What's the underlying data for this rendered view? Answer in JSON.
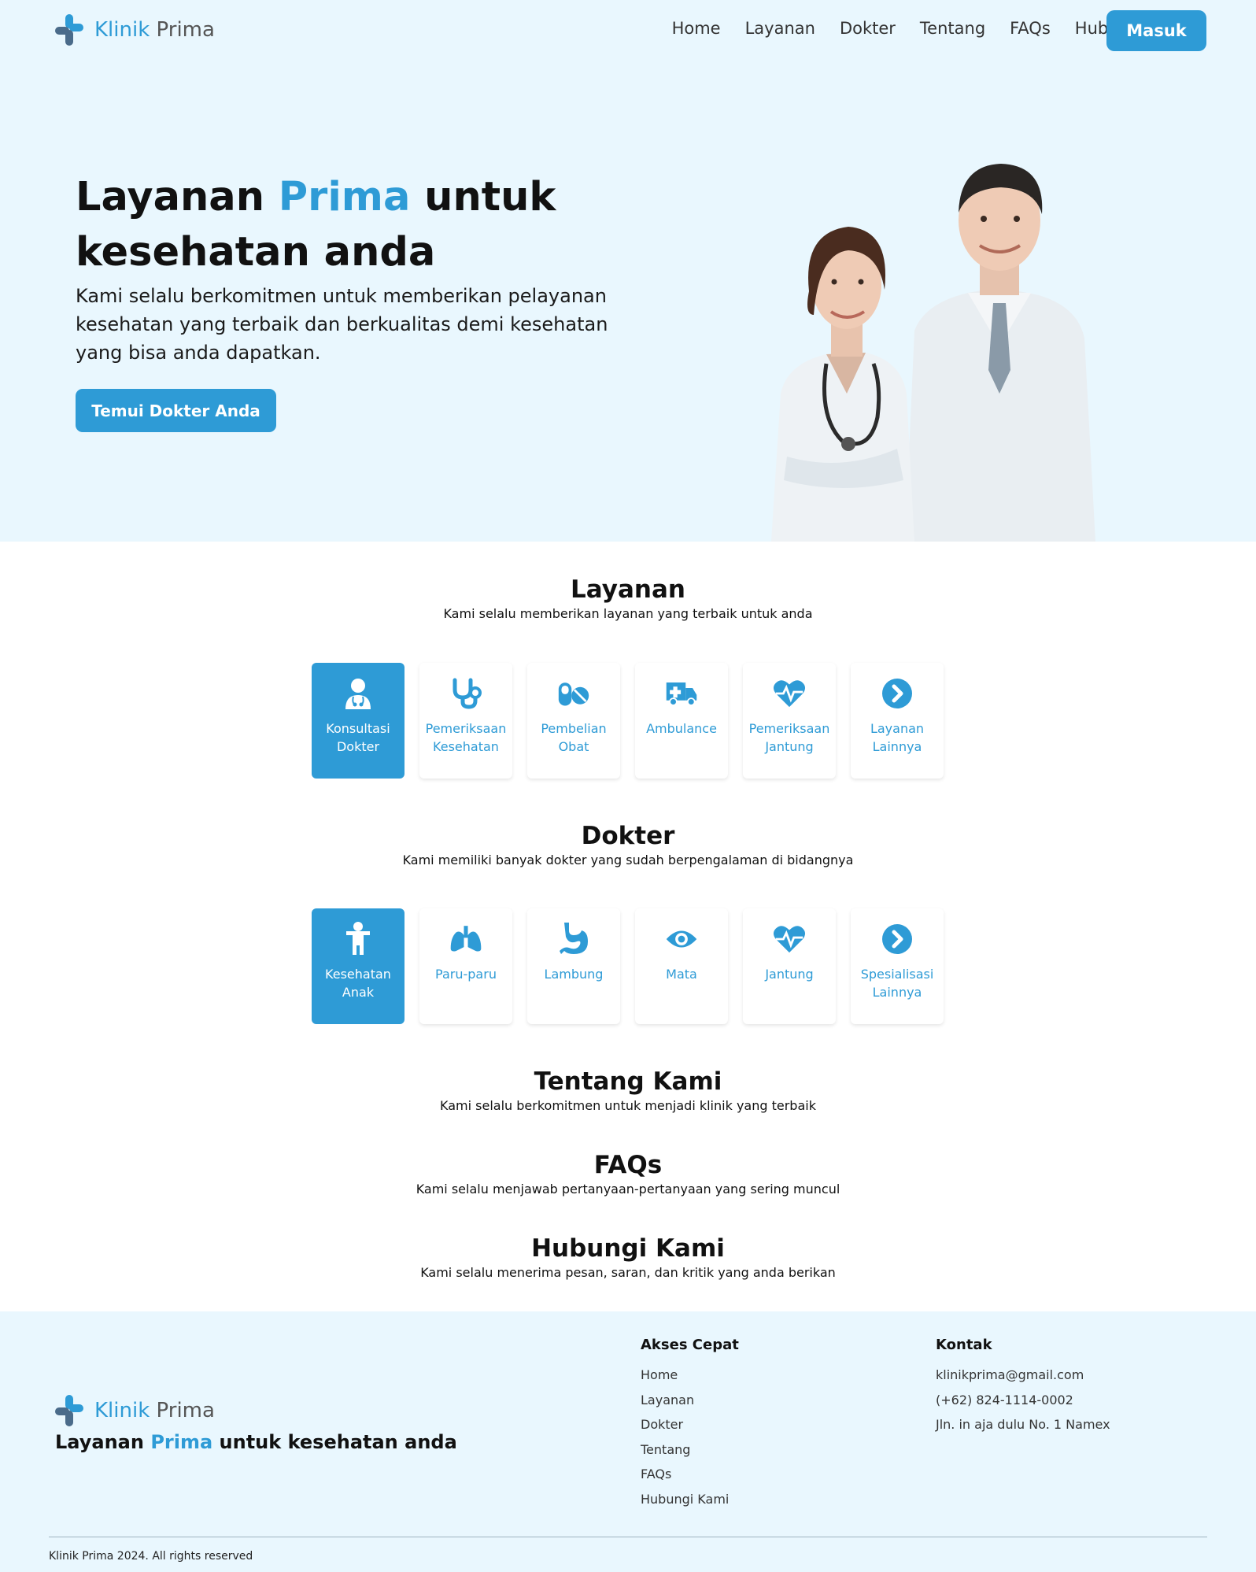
{
  "nav": {
    "brand_first": "Klinik",
    "brand_second": "Prima",
    "links": [
      "Home",
      "Layanan",
      "Dokter",
      "Tentang",
      "FAQs",
      "Hubungi"
    ],
    "login_label": "Masuk"
  },
  "hero": {
    "title_part1": "Layanan ",
    "title_accent": "Prima",
    "title_part2": " untuk kesehatan anda",
    "description": "Kami selalu berkomitmen untuk memberikan pelayanan kesehatan yang terbaik dan berkualitas demi kesehatan yang bisa anda dapatkan.",
    "cta_label": "Temui Dokter Anda"
  },
  "layanan": {
    "title": "Layanan",
    "subtitle": "Kami selalu memberikan layanan yang terbaik untuk anda",
    "cards": [
      {
        "label": "Konsultasi Dokter",
        "icon": "doctor-icon",
        "active": true
      },
      {
        "label": "Pemeriksaan Kesehatan",
        "icon": "stethoscope-icon",
        "active": false
      },
      {
        "label": "Pembelian Obat",
        "icon": "pills-icon",
        "active": false
      },
      {
        "label": "Ambulance",
        "icon": "ambulance-icon",
        "active": false
      },
      {
        "label": "Pemeriksaan Jantung",
        "icon": "heart-pulse-icon",
        "active": false
      },
      {
        "label": "Layanan Lainnya",
        "icon": "chevron-right-circle-icon",
        "active": false
      }
    ]
  },
  "dokter": {
    "title": "Dokter",
    "subtitle": "Kami memiliki banyak dokter yang sudah berpengalaman di bidangnya",
    "cards": [
      {
        "label": "Kesehatan Anak",
        "icon": "child-icon",
        "active": true
      },
      {
        "label": "Paru-paru",
        "icon": "lungs-icon",
        "active": false
      },
      {
        "label": "Lambung",
        "icon": "stomach-icon",
        "active": false
      },
      {
        "label": "Mata",
        "icon": "eye-icon",
        "active": false
      },
      {
        "label": "Jantung",
        "icon": "heart-pulse-icon",
        "active": false
      },
      {
        "label": "Spesialisasi Lainnya",
        "icon": "chevron-right-circle-icon",
        "active": false
      }
    ]
  },
  "tentang": {
    "title": "Tentang Kami",
    "subtitle": "Kami selalu berkomitmen untuk menjadi klinik yang terbaik"
  },
  "faqs": {
    "title": "FAQs",
    "subtitle": "Kami selalu menjawab pertanyaan-pertanyaan yang sering muncul"
  },
  "hubungi": {
    "title": "Hubungi Kami",
    "subtitle": "Kami selalu menerima pesan, saran, dan kritik yang anda berikan"
  },
  "footer": {
    "brand_first": "Klinik",
    "brand_second": "Prima",
    "tagline_part1": "Layanan ",
    "tagline_accent": "Prima",
    "tagline_part2": " untuk kesehatan anda",
    "quick_title": "Akses Cepat",
    "quick_links": [
      "Home",
      "Layanan",
      "Dokter",
      "Tentang",
      "FAQs",
      "Hubungi Kami"
    ],
    "contact_title": "Kontak",
    "contact_items": [
      "klinikprima@gmail.com",
      "(+62) 824-1114-0002",
      "Jln. in aja dulu No. 1 Namex"
    ],
    "copyright": "Klinik Prima 2024. All rights reserved"
  },
  "colors": {
    "accent": "#2e9bd6",
    "hero_bg": "#e9f7fe",
    "logo_dark": "#4a6b8a"
  }
}
